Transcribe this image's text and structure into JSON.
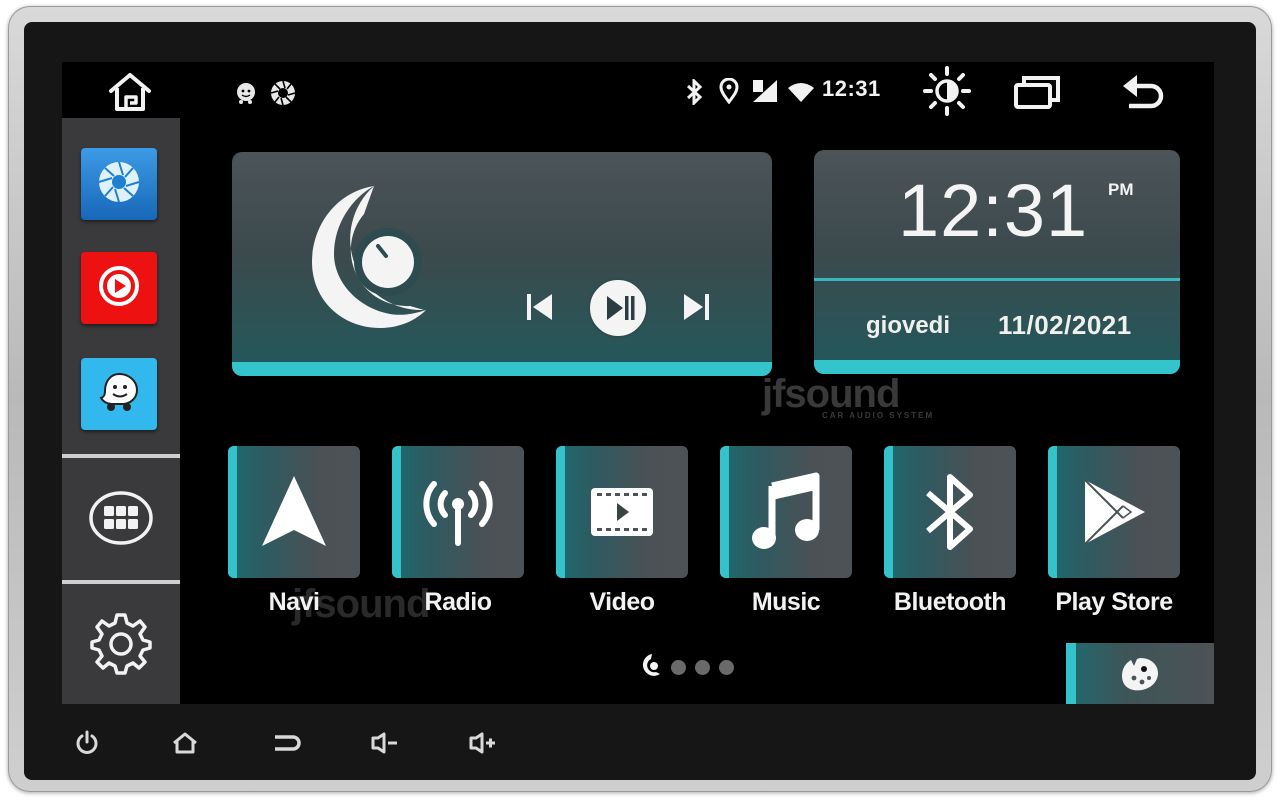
{
  "status_bar": {
    "time": "12:31",
    "left_icons": [
      "home-icon",
      "notification-app-icon",
      "camera-aperture-icon"
    ],
    "right_icons": [
      "bluetooth-icon",
      "location-pin-icon",
      "cellular-signal-icon",
      "wifi-icon",
      "brightness-icon",
      "recent-apps-icon",
      "back-icon"
    ]
  },
  "sidebar": {
    "apps": [
      {
        "name": "camera-app",
        "icon": "aperture-icon",
        "color": "#1f7fd0"
      },
      {
        "name": "youtube-app",
        "icon": "play-circle-icon",
        "color": "#ee1111"
      },
      {
        "name": "waze-app",
        "icon": "waze-icon",
        "color": "#33b8ee"
      }
    ],
    "all_apps_icon": "app-grid-icon",
    "settings_icon": "gear-icon"
  },
  "music_widget": {
    "logo": "jfsound-logo-icon",
    "controls": [
      "previous-track",
      "play-pause",
      "next-track"
    ]
  },
  "clock_widget": {
    "time": "12:31",
    "ampm": "PM",
    "day": "giovedi",
    "date": "11/02/2021"
  },
  "apps": [
    {
      "label": "Navi",
      "icon": "navigation-arrow-icon"
    },
    {
      "label": "Radio",
      "icon": "radio-antenna-icon"
    },
    {
      "label": "Video",
      "icon": "video-player-icon"
    },
    {
      "label": "Music",
      "icon": "music-note-icon"
    },
    {
      "label": "Bluetooth",
      "icon": "bluetooth-icon"
    },
    {
      "label": "Play Store",
      "icon": "play-store-icon"
    }
  ],
  "pager": {
    "page_count": 4,
    "current_page": 1
  },
  "theme_button": {
    "icon": "palette-icon"
  },
  "hardware_buttons": [
    "power",
    "home",
    "back",
    "volume-down",
    "volume-up"
  ],
  "watermark": {
    "brand": "jfsound",
    "tagline": "CAR AUDIO SYSTEM"
  },
  "colors": {
    "accent": "#35c3cb",
    "screen_bg": "#000000",
    "sidebar_bg": "#3a3a3c",
    "tile_bg": "#4d5256",
    "text": "#f2f2f2"
  }
}
